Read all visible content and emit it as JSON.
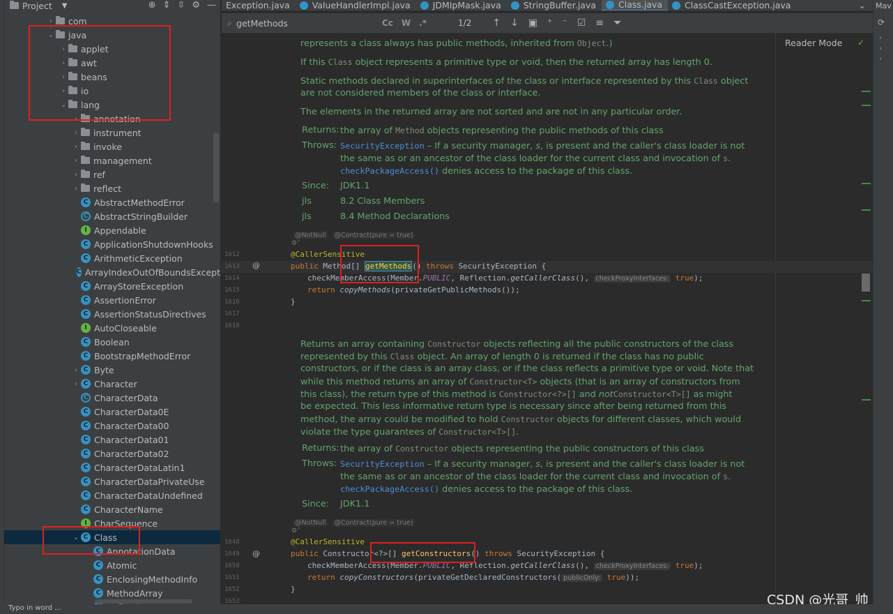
{
  "project_panel": {
    "title": "Project",
    "tree": [
      {
        "label": "com",
        "type": "folder",
        "indent": 0,
        "expanded": false
      },
      {
        "label": "java",
        "type": "folder",
        "indent": 0,
        "expanded": true
      },
      {
        "label": "applet",
        "type": "folder",
        "indent": 1,
        "expanded": false
      },
      {
        "label": "awt",
        "type": "folder",
        "indent": 1,
        "expanded": false
      },
      {
        "label": "beans",
        "type": "folder",
        "indent": 1,
        "expanded": false
      },
      {
        "label": "io",
        "type": "folder",
        "indent": 1,
        "expanded": false
      },
      {
        "label": "lang",
        "type": "folder",
        "indent": 1,
        "expanded": true
      },
      {
        "label": "annotation",
        "type": "folder",
        "indent": 2,
        "expanded": false
      },
      {
        "label": "instrument",
        "type": "folder",
        "indent": 2,
        "expanded": false
      },
      {
        "label": "invoke",
        "type": "folder",
        "indent": 2,
        "expanded": false
      },
      {
        "label": "management",
        "type": "folder",
        "indent": 2,
        "expanded": false
      },
      {
        "label": "ref",
        "type": "folder",
        "indent": 2,
        "expanded": false
      },
      {
        "label": "reflect",
        "type": "folder",
        "indent": 2,
        "expanded": false
      },
      {
        "label": "AbstractMethodError",
        "type": "class",
        "indent": 2
      },
      {
        "label": "AbstractStringBuilder",
        "type": "abstract",
        "indent": 2
      },
      {
        "label": "Appendable",
        "type": "interface",
        "indent": 2
      },
      {
        "label": "ApplicationShutdownHooks",
        "type": "class",
        "indent": 2
      },
      {
        "label": "ArithmeticException",
        "type": "class",
        "indent": 2
      },
      {
        "label": "ArrayIndexOutOfBoundsExcept",
        "type": "class",
        "indent": 2
      },
      {
        "label": "ArrayStoreException",
        "type": "class",
        "indent": 2
      },
      {
        "label": "AssertionError",
        "type": "class",
        "indent": 2
      },
      {
        "label": "AssertionStatusDirectives",
        "type": "class",
        "indent": 2
      },
      {
        "label": "AutoCloseable",
        "type": "interface",
        "indent": 2
      },
      {
        "label": "Boolean",
        "type": "class",
        "indent": 2
      },
      {
        "label": "BootstrapMethodError",
        "type": "class",
        "indent": 2
      },
      {
        "label": "Byte",
        "type": "class",
        "indent": 2,
        "expandable": true
      },
      {
        "label": "Character",
        "type": "class",
        "indent": 2,
        "expandable": true
      },
      {
        "label": "CharacterData",
        "type": "abstract",
        "indent": 2
      },
      {
        "label": "CharacterData0E",
        "type": "class",
        "indent": 2
      },
      {
        "label": "CharacterData00",
        "type": "class",
        "indent": 2
      },
      {
        "label": "CharacterData01",
        "type": "class",
        "indent": 2
      },
      {
        "label": "CharacterData02",
        "type": "class",
        "indent": 2
      },
      {
        "label": "CharacterDataLatin1",
        "type": "class",
        "indent": 2
      },
      {
        "label": "CharacterDataPrivateUse",
        "type": "class",
        "indent": 2
      },
      {
        "label": "CharacterDataUndefined",
        "type": "class",
        "indent": 2
      },
      {
        "label": "CharacterName",
        "type": "class",
        "indent": 2
      },
      {
        "label": "CharSequence",
        "type": "interface",
        "indent": 2
      },
      {
        "label": "Class",
        "type": "class",
        "indent": 2,
        "expanded": true,
        "selected": true
      },
      {
        "label": "AnnotationData",
        "type": "class",
        "indent": 3
      },
      {
        "label": "Atomic",
        "type": "class",
        "indent": 3
      },
      {
        "label": "EnclosingMethodInfo",
        "type": "class",
        "indent": 3
      },
      {
        "label": "MethodArray",
        "type": "class",
        "indent": 3
      },
      {
        "label": "ReflectionData",
        "type": "class",
        "indent": 3
      }
    ]
  },
  "tabs": [
    {
      "label": "Exception.java",
      "active": false
    },
    {
      "label": "ValueHandlerImpl.java",
      "active": false
    },
    {
      "label": "JDMIpMask.java",
      "active": false
    },
    {
      "label": "StringBuffer.java",
      "active": false
    },
    {
      "label": "Class.java",
      "active": true
    },
    {
      "label": "ClassCastException.java",
      "active": false
    }
  ],
  "find": {
    "query": "getMethods",
    "count": "1/2",
    "opts": [
      "Cc",
      "W",
      ".*"
    ]
  },
  "reader_mode": "Reader Mode",
  "doc1": {
    "line0": "represents a class always has public methods, inherited from ",
    "line0_code": "Object",
    "p1": "If this ",
    "p1_code": "Class",
    "p1_rest": " object represents a primitive type or void, then the returned array has length 0.",
    "p2a": "Static methods declared in superinterfaces of the class or interface represented by this ",
    "p2_code": "Class",
    "p2b": " object",
    "p2c": "are not considered members of the class or interface.",
    "p3": "The elements in the returned array are not sorted and are not in any particular order.",
    "returns_label": "Returns:",
    "returns_a": "the array of ",
    "returns_code": "Method",
    "returns_b": " objects representing the public methods of this class",
    "throws_label": "Throws:",
    "throws_link": "SecurityException",
    "throws_a": " – If a security manager, ",
    "throws_s": "s",
    "throws_b": ", is present and the caller's class loader is not",
    "throws_c": "the same as or an ancestor of the class loader for the current class and invocation of ",
    "throws_s2": "s",
    "throws_d": ".",
    "throws_link2": "checkPackageAccess()",
    "throws_e": " denies access to the package of this class.",
    "since_label": "Since:",
    "since": "JDK1.1",
    "jls1_label": "jls",
    "jls1": "8.2 Class Members",
    "jls2_label": "jls",
    "jls2": "8.4 Method Declarations"
  },
  "hints": {
    "notnull": "@NotNull",
    "contract": "@Contract(pure = true)",
    "checkproxy": "checkProxyInterfaces:",
    "publiconly": "publicOnly:"
  },
  "code1": {
    "ln": [
      "1612",
      "1613",
      "1614",
      "1615",
      "1616",
      "1617",
      "1618"
    ],
    "annotation": "@CallerSensitive",
    "sig_public": "public ",
    "sig_type": "Method[] ",
    "sig_name": "getMethods",
    "sig_paren": "() ",
    "sig_throws": "throws ",
    "sig_exc": "SecurityException {",
    "l2a": "checkMemberAccess(Member.",
    "l2const": "PUBLIC",
    "l2b": ", Reflection.",
    "l2call": "getCallerClass",
    "l2c": "(), ",
    "l2true": "true",
    "l2d": ");",
    "l3ret": "return ",
    "l3call": "copyMethods",
    "l3rest": "(privateGetPublicMethods());",
    "close": "}"
  },
  "doc2": {
    "l1a": "Returns an array containing ",
    "l1code": "Constructor",
    "l1b": " objects reflecting all the public constructors of the class",
    "l2a": "represented by this ",
    "l2code": "Class",
    "l2b": " object. An array of length 0 is returned if the class has no public",
    "l3": "constructors, or if the class is an array class, or if the class reflects a primitive type or void. Note that",
    "l4a": "while this method returns an array of ",
    "l4code": "Constructor<T>",
    "l4b": " objects (that is an array of constructors from",
    "l5a": "this class), the return type of this method is ",
    "l5code": "Constructor<?>[]",
    "l5b": " and ",
    "l5not": "not",
    "l5code2": "Constructor<T>[]",
    "l5c": " as might",
    "l6": "be expected. This less informative return type is necessary since after being returned from this",
    "l7": "method, the array could be modified to hold ",
    "l7code": "Constructor",
    "l7b": " objects for different classes, which would",
    "l8a": "violate the type guarantees of ",
    "l8code": "Constructor<T>[]",
    "l8b": ".",
    "returns_label": "Returns:",
    "returns_a": "the array of ",
    "returns_code": "Constructor",
    "returns_b": " objects representing the public constructors of this class",
    "throws_label": "Throws:",
    "throws_link": "SecurityException",
    "throws_a": " – If a security manager, ",
    "throws_s": "s",
    "throws_b": ", is present and the caller's class loader is not",
    "throws_c": "the same as or an ancestor of the class loader for the current class and invocation of ",
    "throws_s2": "s",
    "throws_d": ".",
    "throws_link2": "checkPackageAccess()",
    "throws_e": " denies access to the package of this class.",
    "since_label": "Since:",
    "since": "JDK1.1"
  },
  "code2": {
    "ln": [
      "1648",
      "1649",
      "1650",
      "1651",
      "1652",
      "1653"
    ],
    "annotation": "@CallerSensitive",
    "sig_public": "public ",
    "sig_type": "Constructor<?>[] ",
    "sig_name": "getConstructors",
    "sig_paren": "() ",
    "sig_throws": "throws ",
    "sig_exc": "SecurityException {",
    "l2a": "checkMemberAccess(Member.",
    "l2const": "PUBLIC",
    "l2b": ", Reflection.",
    "l2call": "getCallerClass",
    "l2c": "(), ",
    "l2true": "true",
    "l2d": ");",
    "l3ret": "return ",
    "l3call": "copyConstructors",
    "l3rest": "(privateGetDeclaredConstructors(",
    "l3true": "true",
    "l3end": "));",
    "close": "}"
  },
  "right_panel": {
    "title": "Mav"
  },
  "watermark": "CSDN @光哥_帅",
  "statusbar": "Typo in word ...",
  "colors": {
    "accent": "#4a88c7",
    "annotation_box": "#e02020",
    "doc_text": "#64a36c"
  }
}
